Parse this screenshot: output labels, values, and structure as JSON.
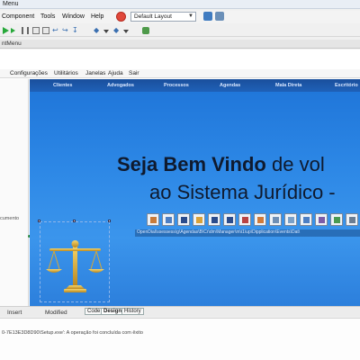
{
  "window": {
    "title": "Menu"
  },
  "menu_bar": {
    "items": [
      "Component",
      "Tools",
      "Window",
      "Help"
    ],
    "layout_select": {
      "value": "Default Layout"
    }
  },
  "document_tab": {
    "label": "ntMenu"
  },
  "form": {
    "menu": [
      "Configurações",
      "Utilitários",
      "Janelas",
      "Ajuda",
      "Sair"
    ],
    "nav": [
      "Clientes",
      "Advogados",
      "Processos",
      "Agendas",
      "Mala Direta",
      "Escritório"
    ],
    "welcome_bold": "Seja Bem Vindo",
    "welcome_rest": "de vol",
    "subtitle": "ao Sistema Jurídico -",
    "component_names": "OpenDial\\ssessess\\g\\Agendas\\B\\Cr\\dm\\Manager\\m\\i1\\up\\Dipplication\\Events\\Dat\\",
    "left_panel_fragment": "cumento"
  },
  "status_bar": {
    "insert": "Insert",
    "modified": "Modified",
    "tabs": [
      "Code",
      "Design",
      "History"
    ],
    "active_tab": "Design"
  },
  "messages": {
    "line": "0-7E13E3D8D90\\Setup.exe': A operação foi concluída com êxito"
  },
  "colors": {
    "accent_blue": "#2d88e6",
    "nav_dark": "#1a4f9c",
    "run_green": "#27a83a",
    "alert_red": "#e0483a"
  },
  "icons": [
    "alert-icon",
    "run-icon",
    "step-icon",
    "gavel-scales-icon"
  ]
}
